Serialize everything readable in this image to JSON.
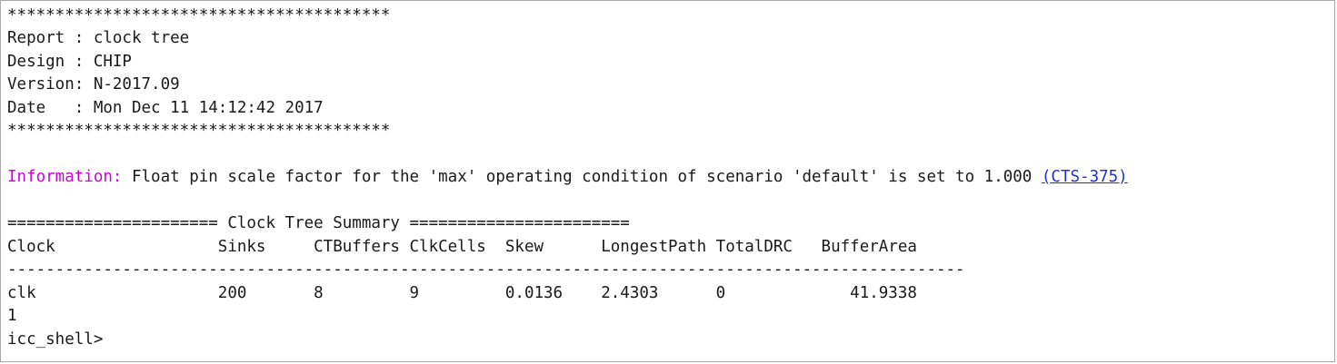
{
  "header": {
    "stars_top": "****************************************",
    "report_line": "Report : clock tree",
    "design_line": "Design : CHIP",
    "version_line": "Version: N-2017.09",
    "date_line": "Date   : Mon Dec 11 14:12:42 2017",
    "stars_bottom": "****************************************"
  },
  "info": {
    "label": "Information:",
    "message": " Float pin scale factor for the 'max' operating condition of scenario 'default' is set to 1.000 ",
    "link_text": "(CTS-375)"
  },
  "summary": {
    "title_line": "====================== Clock Tree Summary =======================",
    "header_row": "Clock                 Sinks     CTBuffers ClkCells  Skew      LongestPath TotalDRC   BufferArea",
    "separator": "----------------------------------------------------------------------------------------------------",
    "data_row": "clk                   200       8         9         0.0136    2.4303      0             41.9338"
  },
  "footer": {
    "return_value": "1",
    "prompt": "icc_shell>"
  }
}
